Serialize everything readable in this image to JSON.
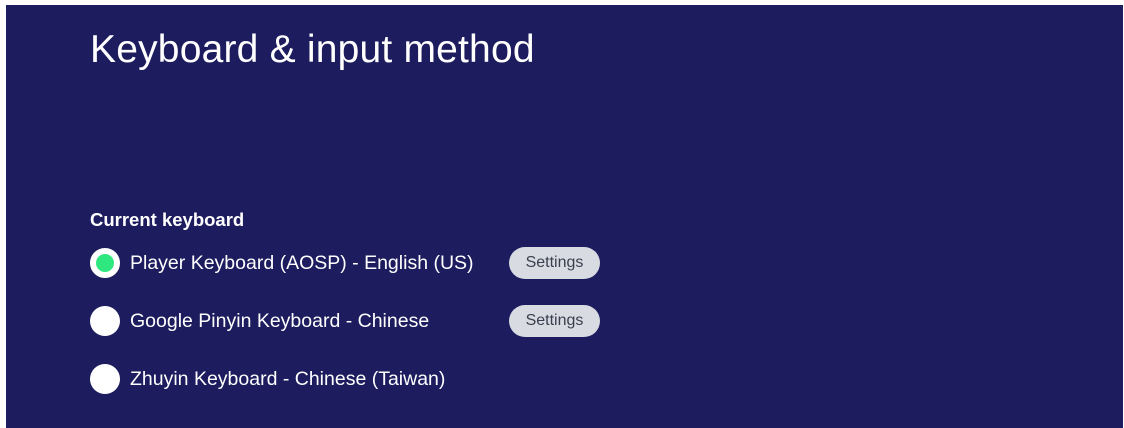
{
  "page": {
    "title": "Keyboard & input method"
  },
  "section": {
    "heading": "Current keyboard"
  },
  "keyboards": [
    {
      "label": "Player Keyboard (AOSP) - English (US)",
      "selected": true,
      "settings_label": "Settings"
    },
    {
      "label": "Google Pinyin Keyboard - Chinese",
      "selected": false,
      "settings_label": "Settings"
    },
    {
      "label": "Zhuyin Keyboard - Chinese (Taiwan)",
      "selected": false
    }
  ],
  "colors": {
    "background": "#1c1c5e",
    "radio_selected_dot": "#2ee87f",
    "button_background": "#d9dbe2"
  }
}
